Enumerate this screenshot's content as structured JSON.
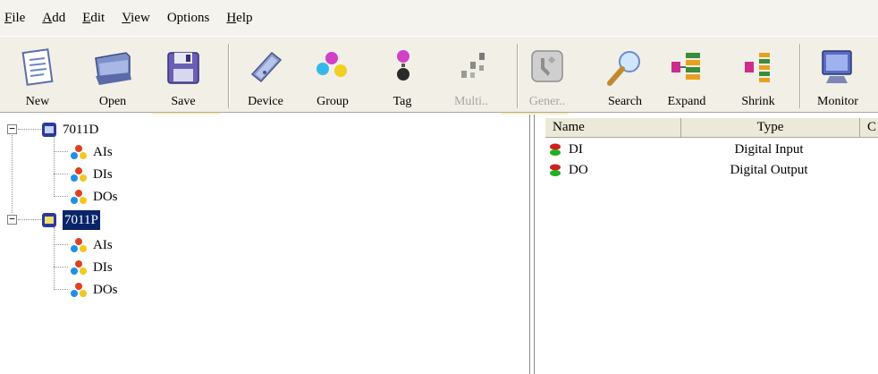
{
  "menu": {
    "items": [
      {
        "label": "File",
        "accel": "F",
        "rest": "ile"
      },
      {
        "label": "Add",
        "accel": "A",
        "rest": "dd"
      },
      {
        "label": "Edit",
        "accel": "E",
        "rest": "dit"
      },
      {
        "label": "View",
        "accel": "V",
        "rest": "iew"
      },
      {
        "label": "Options",
        "accel": "",
        "rest": "Options"
      },
      {
        "label": "Help",
        "accel": "H",
        "rest": "elp"
      }
    ]
  },
  "toolbar": {
    "new": "New",
    "open": "Open",
    "save": "Save",
    "device": "Device",
    "group": "Group",
    "tag": "Tag",
    "multi": "Multi..",
    "gener": "Gener..",
    "search": "Search",
    "expand": "Expand",
    "shrink": "Shrink",
    "monitor": "Monitor"
  },
  "tree": {
    "devices": [
      {
        "name": "7011D",
        "children": [
          "AIs",
          "DIs",
          "DOs"
        ]
      },
      {
        "name": "7011P",
        "children": [
          "AIs",
          "DIs",
          "DOs"
        ]
      }
    ],
    "expander_symbol": "−"
  },
  "list": {
    "columns": [
      "Name",
      "Type",
      "C"
    ],
    "rows": [
      {
        "name": "DI",
        "type": "Digital Input"
      },
      {
        "name": "DO",
        "type": "Digital Output"
      }
    ]
  },
  "colors": {
    "selection": "#0a246a",
    "toolbar_bg": "#f1efe6",
    "header_bg": "#ece9d8"
  },
  "icons": {
    "new": "document-icon",
    "open": "folder-tray-icon",
    "save": "floppy-disk-icon",
    "device": "device-module-icon",
    "group": "colored-balls-icon",
    "tag": "tag-balls-icon",
    "multi": "multi-dots-icon",
    "gener": "wrench-tool-icon",
    "search": "magnifier-icon",
    "expand": "expand-tree-icon",
    "shrink": "shrink-tree-icon",
    "monitor": "monitor-icon"
  }
}
